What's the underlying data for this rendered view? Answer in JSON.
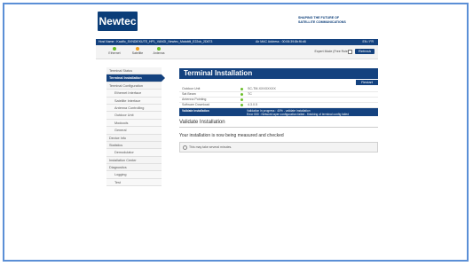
{
  "header": {
    "logo": "Newtec",
    "tagline_line1": "SHAPING THE FUTURE OF",
    "tagline_line2": "SATELLITE COMMUNICATIONS"
  },
  "topbar": {
    "host": "Host Name : Kacific_SVNDIEKUTE_HP1_VANGI_Newtec_Matabiti_E22ok_2D673",
    "mac": "Air MAC Address : 00:06:39:8b:f6:d6",
    "lang": "EN / FR"
  },
  "status": [
    {
      "label": "Ethernet",
      "color": "#6cbf2a"
    },
    {
      "label": "Satellite",
      "color": "#f0a020"
    },
    {
      "label": "Antenna",
      "color": "#6cbf2a"
    }
  ],
  "expert_mode": "Expert Mode (Free Role)",
  "refresh": "Refresh",
  "sidebar": [
    {
      "label": "Terminal Status",
      "level": 0
    },
    {
      "label": "Terminal Installation",
      "level": 0,
      "active": true
    },
    {
      "label": "Terminal Configuration",
      "level": 0
    },
    {
      "label": "Ethernet Interface",
      "level": 1
    },
    {
      "label": "Satellite Interface",
      "level": 1
    },
    {
      "label": "Antenna Controlling",
      "level": 1
    },
    {
      "label": "Outdoor Unit",
      "level": 1
    },
    {
      "label": "Modcods",
      "level": 1
    },
    {
      "label": "General",
      "level": 1
    },
    {
      "label": "Device Info",
      "level": 0
    },
    {
      "label": "Statistics",
      "level": 0
    },
    {
      "label": "Demodulator",
      "level": 1
    },
    {
      "label": "Installation Center",
      "level": 0
    },
    {
      "label": "Diagnostics",
      "level": 0
    },
    {
      "label": "Logging",
      "level": 1
    },
    {
      "label": "Test",
      "level": 1
    }
  ],
  "main": {
    "title": "Terminal Installation",
    "restart": "Restart",
    "rows": [
      {
        "key": "Outdoor Unit",
        "value": "SC-TM-XXXXXXXX"
      },
      {
        "key": "Sat Beam",
        "value": "TC"
      },
      {
        "key": "Antenna Pointing",
        "value": ""
      },
      {
        "key": "Software Download",
        "value": "4.3.0.5"
      }
    ],
    "validate": {
      "key": "Validate installation",
      "line1": "Validation in progress : 40% - validate installation",
      "line2": "Error 000 : Network layer configuration failed - finishing of terminal config failed"
    },
    "section_title": "Validate Installation",
    "message": "Your installation is now being measured and checked",
    "info": "This may take several minutes."
  }
}
